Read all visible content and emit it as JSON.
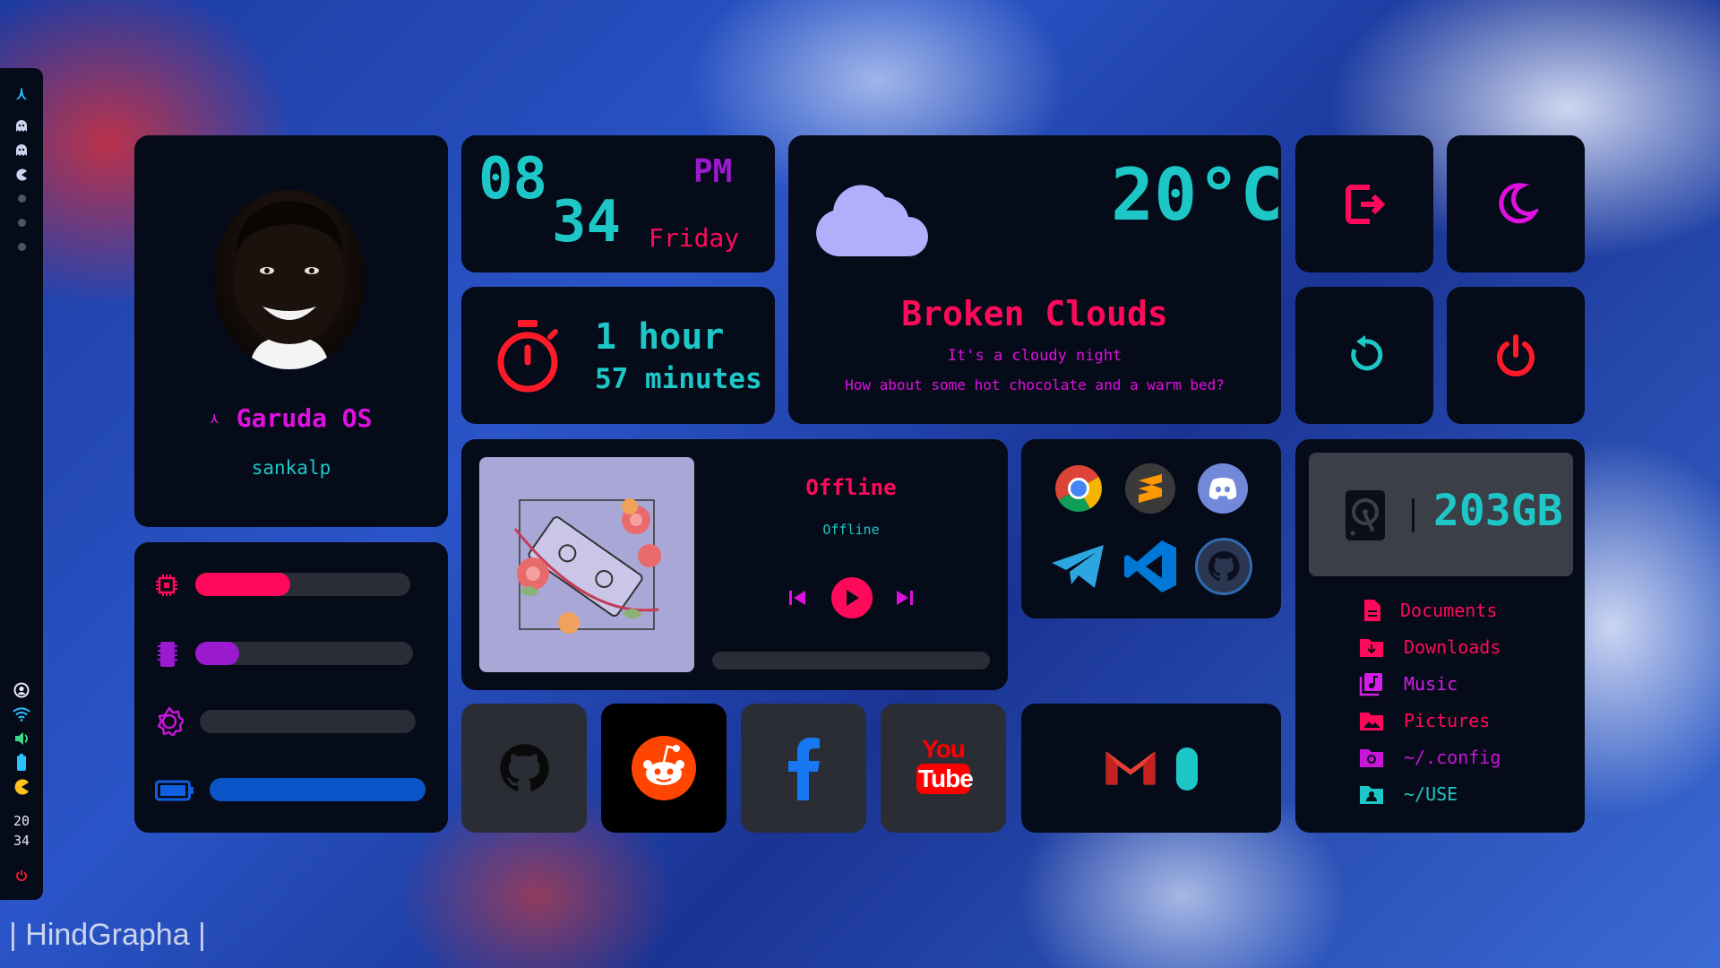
{
  "sidebar": {
    "time_hour": "20",
    "time_min": "34"
  },
  "profile": {
    "os_name": "Garuda OS",
    "username": "sankalp"
  },
  "clock": {
    "hour": "08",
    "minute": "34",
    "ampm": "PM",
    "day": "Friday"
  },
  "uptime": {
    "hours": "1 hour",
    "minutes": "57 minutes"
  },
  "weather": {
    "temperature": "20°C",
    "condition": "Broken Clouds",
    "line1": "It's a cloudy night",
    "line2": "How about some hot chocolate and a warm bed?"
  },
  "resources": {
    "cpu_percent": 44,
    "ram_percent": 20,
    "brightness_percent": 0,
    "battery_percent": 100
  },
  "music": {
    "title": "Offline",
    "artist": "Offline",
    "progress_percent": 0
  },
  "apps": [
    "chrome",
    "sublime-text",
    "discord",
    "telegram",
    "vscode",
    "github"
  ],
  "social": [
    "github",
    "reddit",
    "facebook",
    "youtube"
  ],
  "youtube": {
    "you": "You",
    "tube": "Tube"
  },
  "storage": {
    "size": "203GB",
    "folders": [
      {
        "label": "Documents",
        "color": "#ff0a5a"
      },
      {
        "label": "Downloads",
        "color": "#ff0a5a"
      },
      {
        "label": "Music",
        "color": "#d51ee8"
      },
      {
        "label": "Pictures",
        "color": "#ff0a5a"
      },
      {
        "label": "~/.config",
        "color": "#c716d8"
      },
      {
        "label": "~/USE",
        "color": "#1ec7c7"
      }
    ]
  },
  "watermark": "| HindGrapha |",
  "colors": {
    "cyan": "#1ec7c7",
    "pink": "#ff0a5a",
    "magenta": "#e010e0",
    "purple": "#9b1ad0",
    "red": "#ff1a2a",
    "card": "#050b18"
  }
}
